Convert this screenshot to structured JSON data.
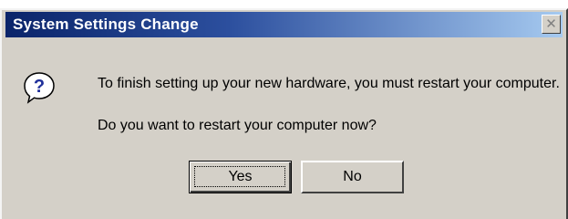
{
  "window": {
    "title": "System Settings Change",
    "close_icon": "close-icon"
  },
  "message": {
    "icon": "question-icon",
    "line1": "To finish setting up your new hardware, you must restart your computer.",
    "line2": "Do you want to restart your computer now?"
  },
  "buttons": {
    "yes_label": "Yes",
    "no_label": "No"
  },
  "colors": {
    "titlebar_start": "#0a246a",
    "titlebar_end": "#a6caf0",
    "dialog_face": "#d4d0c8",
    "icon_blue": "#1f2f9a"
  }
}
